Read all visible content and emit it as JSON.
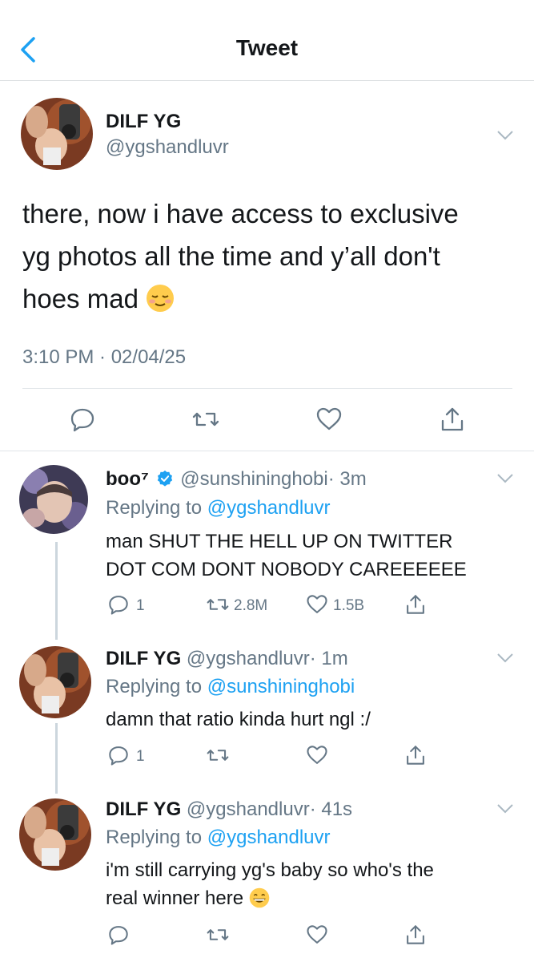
{
  "header": {
    "title": "Tweet"
  },
  "main_tweet": {
    "name": "DILF YG",
    "handle": "@ygshandluvr",
    "text_line1": "there, now i have access to exclusive",
    "text_line2": "yg photos all the time and y’all don't",
    "text_line3": "hoes mad",
    "emoji": "relieved-face",
    "timestamp": "3:10 PM · 02/04/25"
  },
  "replies": [
    {
      "name": "boo⁷",
      "verified": true,
      "handle": "@sunshininghobi",
      "time": "· 3m",
      "replying_prefix": "Replying to",
      "replying_to": "@ygshandluvr",
      "text_line1": "man SHUT THE HELL UP ON TWITTER",
      "text_line2": "DOT COM DONT NOBODY CAREEEEEE",
      "reply_count": "1",
      "retweet_count": "2.8M",
      "like_count": "1.5B"
    },
    {
      "name": "DILF YG",
      "handle": "@ygshandluvr",
      "time": "· 1m",
      "replying_prefix": "Replying to",
      "replying_to": "@sunshininghobi",
      "text_line1": "damn that ratio kinda hurt ngl :/",
      "reply_count": "1"
    },
    {
      "name": "DILF YG",
      "handle": "@ygshandluvr",
      "time": "· 41s",
      "replying_prefix": "Replying to",
      "replying_to": "@ygshandluvr",
      "text_line1": "i'm still carrying yg's baby so who's the",
      "text_line2": "real winner here",
      "emoji": "grinning-face"
    }
  ],
  "colors": {
    "accent": "#1da1f2",
    "secondary_text": "#657786",
    "divider": "#e1e5e8"
  }
}
